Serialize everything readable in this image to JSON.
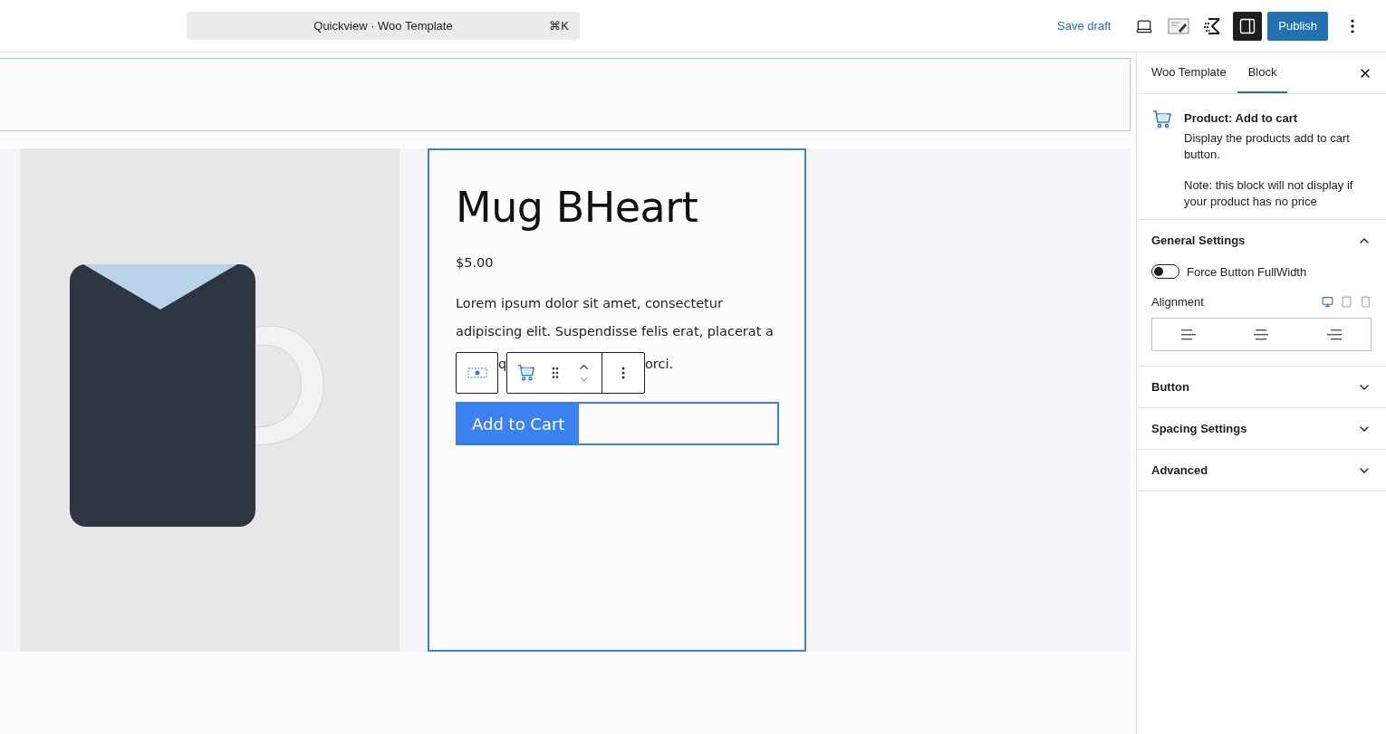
{
  "topbar": {
    "command": {
      "title": "Quickview · Woo Template",
      "shortcut": "⌘K"
    },
    "save_draft": "Save draft",
    "sidebar_toggle": {
      "on": true
    },
    "publish": "Publish"
  },
  "product": {
    "title": "Mug BHeart",
    "price": "$5.00",
    "description_lines": [
      "Lorem ipsum dolor sit amet, consectetur",
      "adipiscing elit. Suspendisse felis erat, placerat a"
    ],
    "covered_line": {
      "before": "q",
      "after": "orci."
    },
    "button": "Add to Cart"
  },
  "sidebar": {
    "tabs": [
      {
        "label": "Woo Template",
        "selected": false
      },
      {
        "label": "Block",
        "selected": true
      }
    ],
    "block": {
      "title": "Product: Add to cart",
      "description": "Display the products add to cart button.",
      "note": "Note: this block will not display if your product has no price"
    },
    "panels": [
      {
        "title": "General Settings",
        "expanded": true
      },
      {
        "title": "Button",
        "expanded": false
      },
      {
        "title": "Spacing Settings",
        "expanded": false
      },
      {
        "title": "Advanced",
        "expanded": false
      }
    ],
    "general": {
      "toggle": {
        "label": "Force Button FullWidth",
        "on": false
      },
      "alignment_label": "Alignment",
      "devices": [
        {
          "kind": "desktop",
          "selected": true
        },
        {
          "kind": "tablet",
          "selected": false
        },
        {
          "kind": "mobile",
          "selected": false
        }
      ],
      "alignments": [
        {
          "kind": "left"
        },
        {
          "kind": "center"
        },
        {
          "kind": "right"
        }
      ]
    }
  }
}
